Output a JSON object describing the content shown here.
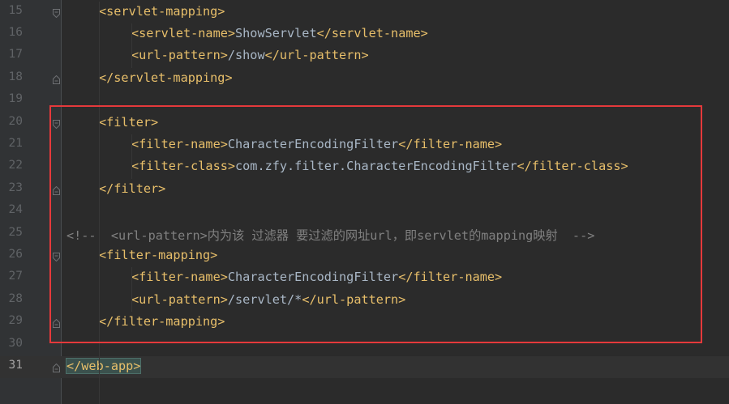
{
  "editor": {
    "accent_tag_color": "#e8bf6a",
    "text_color": "#a9b7c6",
    "comment_color": "#808080",
    "highlight_box_color": "#e5393b",
    "current_line": "31",
    "lines": [
      {
        "num": "15",
        "indent": 1,
        "parts": [
          {
            "t": "<servlet-mapping>",
            "c": "tag"
          }
        ],
        "fold": "open"
      },
      {
        "num": "16",
        "indent": 2,
        "parts": [
          {
            "t": "<servlet-name>",
            "c": "tag"
          },
          {
            "t": "ShowServlet",
            "c": "txt"
          },
          {
            "t": "</servlet-name>",
            "c": "tag"
          }
        ]
      },
      {
        "num": "17",
        "indent": 2,
        "parts": [
          {
            "t": "<url-pattern>",
            "c": "tag"
          },
          {
            "t": "/show",
            "c": "txt"
          },
          {
            "t": "</url-pattern>",
            "c": "tag"
          }
        ]
      },
      {
        "num": "18",
        "indent": 1,
        "parts": [
          {
            "t": "</servlet-mapping>",
            "c": "tag"
          }
        ],
        "fold": "close"
      },
      {
        "num": "19",
        "indent": 0,
        "parts": []
      },
      {
        "num": "20",
        "indent": 1,
        "parts": [
          {
            "t": "<filter>",
            "c": "tag"
          }
        ],
        "fold": "open"
      },
      {
        "num": "21",
        "indent": 2,
        "parts": [
          {
            "t": "<filter-name>",
            "c": "tag"
          },
          {
            "t": "CharacterEncodingFilter",
            "c": "txt"
          },
          {
            "t": "</filter-name>",
            "c": "tag"
          }
        ]
      },
      {
        "num": "22",
        "indent": 2,
        "parts": [
          {
            "t": "<filter-class>",
            "c": "tag"
          },
          {
            "t": "com.zfy.filter.CharacterEncodingFilter",
            "c": "txt"
          },
          {
            "t": "</filter-class>",
            "c": "tag"
          }
        ]
      },
      {
        "num": "23",
        "indent": 1,
        "parts": [
          {
            "t": "</filter>",
            "c": "tag"
          }
        ],
        "fold": "close"
      },
      {
        "num": "24",
        "indent": 0,
        "parts": []
      },
      {
        "num": "25",
        "indent": 0,
        "parts": [
          {
            "t": "<!--  <url-pattern>内为该 过滤器 要过滤的网址url，即servlet的mapping映射  -->",
            "c": "cmt"
          }
        ]
      },
      {
        "num": "26",
        "indent": 1,
        "parts": [
          {
            "t": "<filter-mapping>",
            "c": "tag"
          }
        ],
        "fold": "open"
      },
      {
        "num": "27",
        "indent": 2,
        "parts": [
          {
            "t": "<filter-name>",
            "c": "tag"
          },
          {
            "t": "CharacterEncodingFilter",
            "c": "txt"
          },
          {
            "t": "</filter-name>",
            "c": "tag"
          }
        ]
      },
      {
        "num": "28",
        "indent": 2,
        "parts": [
          {
            "t": "<url-pattern>",
            "c": "tag"
          },
          {
            "t": "/servlet/*",
            "c": "txt"
          },
          {
            "t": "</url-pattern>",
            "c": "tag"
          }
        ]
      },
      {
        "num": "29",
        "indent": 1,
        "parts": [
          {
            "t": "</filter-mapping>",
            "c": "tag"
          }
        ],
        "fold": "close"
      },
      {
        "num": "30",
        "indent": 0,
        "parts": []
      },
      {
        "num": "31",
        "indent": 0,
        "parts": [
          {
            "t": "</web-app>",
            "c": "match"
          }
        ],
        "fold": "close"
      }
    ]
  }
}
